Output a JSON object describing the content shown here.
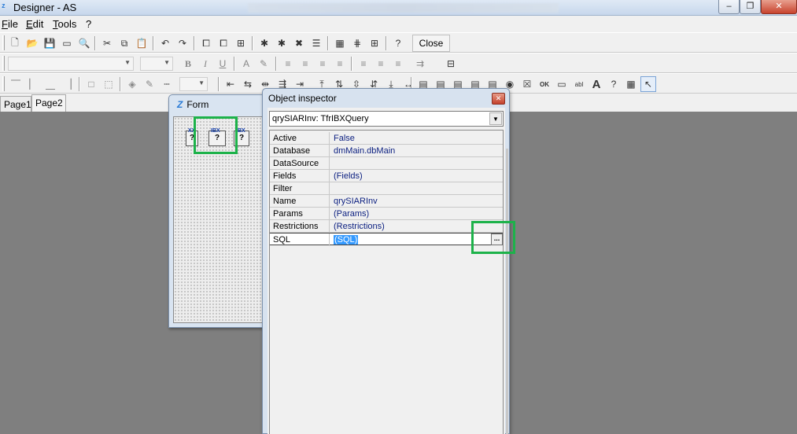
{
  "window": {
    "title": "Designer - AS",
    "min": "–",
    "max": "❐",
    "close": "✕"
  },
  "menu": {
    "file": "File",
    "file_key": "F",
    "edit": "Edit",
    "edit_key": "E",
    "tools": "Tools",
    "tools_key": "T",
    "help": "?"
  },
  "toolbar1": {
    "close_label": "Close"
  },
  "tabs": [
    {
      "label": "Page1",
      "active": false
    },
    {
      "label": "Page2",
      "active": true
    }
  ],
  "form": {
    "title": "Form",
    "components": [
      {
        "icon": "ibx-query-icon",
        "label": "XX"
      },
      {
        "icon": "ibx-query-icon",
        "label": "IBX"
      },
      {
        "icon": "ibx-query-icon",
        "label": "IBX"
      }
    ]
  },
  "inspector": {
    "title": "Object inspector",
    "selected_object": "qrySIARInv: TfrIBXQuery",
    "properties": [
      {
        "name": "Active",
        "value": "False"
      },
      {
        "name": "Database",
        "value": "dmMain.dbMain"
      },
      {
        "name": "DataSource",
        "value": ""
      },
      {
        "name": "Fields",
        "value": "(Fields)"
      },
      {
        "name": "Filter",
        "value": ""
      },
      {
        "name": "Name",
        "value": "qrySIARInv"
      },
      {
        "name": "Params",
        "value": "(Params)"
      },
      {
        "name": "Restrictions",
        "value": "(Restrictions)"
      },
      {
        "name": "SQL",
        "value": "(SQL)",
        "selected": true
      }
    ],
    "ellipsis": "..."
  },
  "colors": {
    "highlight_box": "#1db24a",
    "workspace": "#7f7f7f",
    "selection": "#3399ff"
  }
}
